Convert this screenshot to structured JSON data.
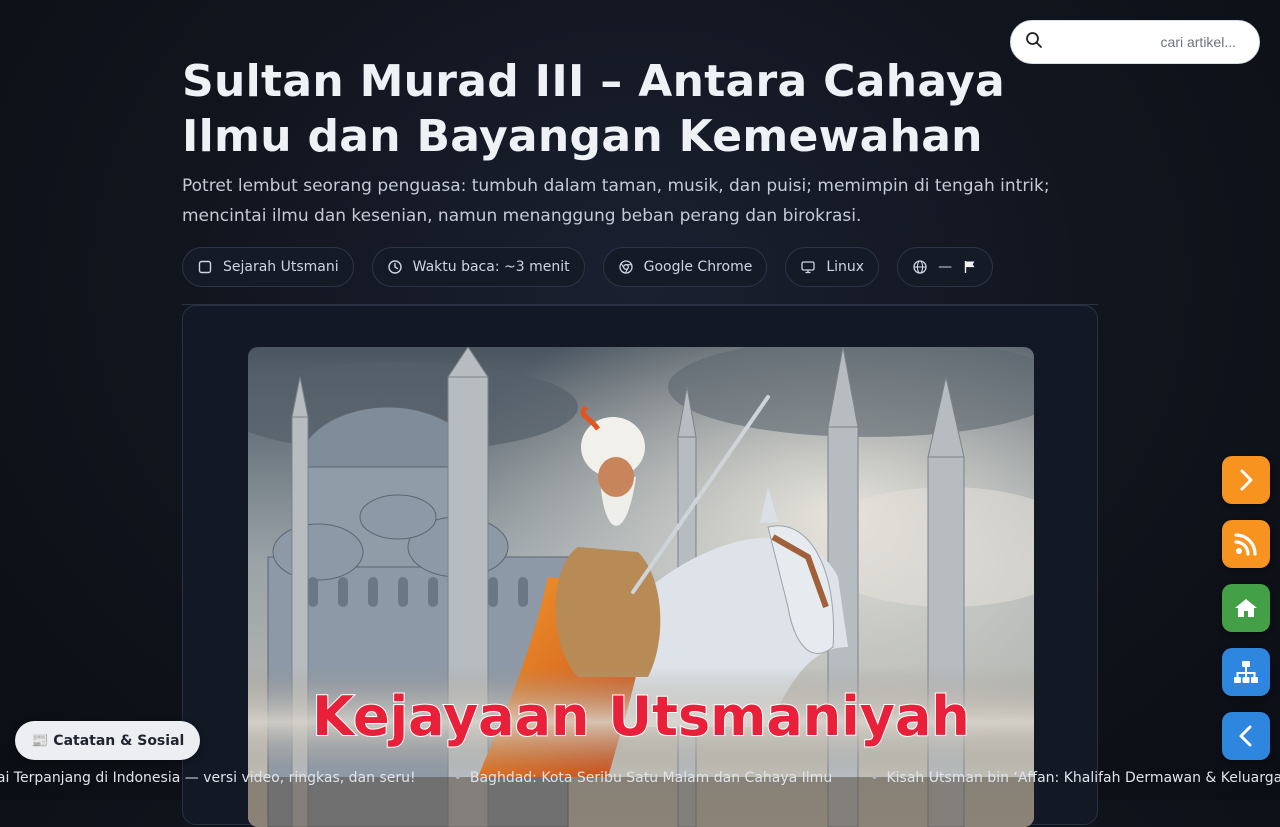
{
  "search": {
    "placeholder": "cari artikel...",
    "value": "",
    "icon": "search-icon"
  },
  "article": {
    "title": "Sultan Murad III – Antara Cahaya Ilmu dan Bayangan Kemewahan",
    "subtitle": "Potret lembut seorang penguasa: tumbuh dalam taman, musik, dan puisi; memimpin di tengah intrik; mencintai ilmu dan kesenian, namun menanggung beban perang dan birokrasi.",
    "meta": [
      {
        "label": "Sejarah Utsmani",
        "icon": "square-icon"
      },
      {
        "label": "Waktu baca: ~3 menit",
        "icon": "clock-icon"
      },
      {
        "label": "Google Chrome",
        "icon": "chrome-icon"
      },
      {
        "label": "Linux",
        "icon": "monitor-icon"
      },
      {
        "label": "—",
        "icon": "globe-icon",
        "flag_icon": "flag-icon"
      }
    ],
    "hero": {
      "overlay_text": "Kejayaan Utsmaniyah",
      "overlay_color": "#e8203a"
    }
  },
  "fabs": [
    {
      "icon": "chevron-right-icon",
      "color": "#f7931e"
    },
    {
      "icon": "rss-icon",
      "color": "#f7931e"
    },
    {
      "icon": "home-icon",
      "color": "#43a047"
    },
    {
      "icon": "sitemap-icon",
      "color": "#2e86de"
    },
    {
      "icon": "chevron-left-icon",
      "color": "#2e86de"
    }
  ],
  "social": {
    "label": "📰 Catatan & Sosial"
  },
  "ticker": {
    "items": [
      "gai Terpanjang di Indonesia — versi video, ringkas, dan seru!",
      "Baghdad: Kota Seribu Satu Malam dan Cahaya Ilmu",
      "Kisah Utsman bin ‘Affan: Khalifah Dermawan & Keluarga Penu"
    ],
    "separator": "•"
  }
}
